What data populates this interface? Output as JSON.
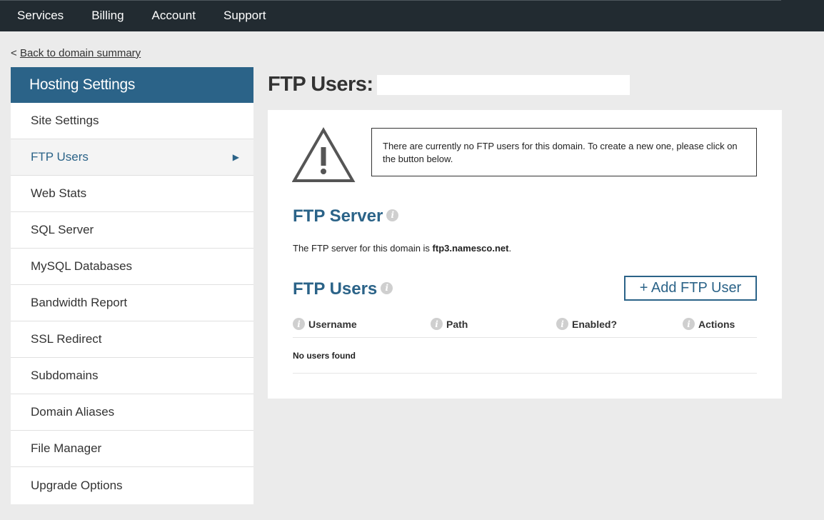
{
  "topnav": {
    "items": [
      "Services",
      "Billing",
      "Account",
      "Support"
    ]
  },
  "back_link": {
    "prefix": "< ",
    "label": "Back to domain summary"
  },
  "sidebar": {
    "title": "Hosting Settings",
    "items": [
      {
        "label": "Site Settings"
      },
      {
        "label": "FTP Users",
        "active": true
      },
      {
        "label": "Web Stats"
      },
      {
        "label": "SQL Server"
      },
      {
        "label": "MySQL Databases"
      },
      {
        "label": "Bandwidth Report"
      },
      {
        "label": "SSL Redirect"
      },
      {
        "label": "Subdomains"
      },
      {
        "label": "Domain Aliases"
      },
      {
        "label": "File Manager"
      },
      {
        "label": "Upgrade Options"
      }
    ],
    "active_arrow": "▶"
  },
  "page": {
    "title": "FTP Users:"
  },
  "notice": {
    "text": "There are currently no FTP users for this domain. To create a new one, please click on the button below."
  },
  "ftp_server": {
    "title": "FTP Server",
    "text_prefix": "The FTP server for this domain is ",
    "host": "ftp3.namesco.net",
    "text_suffix": "."
  },
  "ftp_users": {
    "title": "FTP Users",
    "add_button": "+ Add FTP User",
    "columns": [
      "Username",
      "Path",
      "Enabled?",
      "Actions"
    ],
    "empty_text": "No users found"
  },
  "icons": {
    "info": "i",
    "warning": "warning-triangle-icon"
  },
  "colors": {
    "topbar": "#222b31",
    "accent": "#2b6388",
    "background": "#ebebeb"
  }
}
